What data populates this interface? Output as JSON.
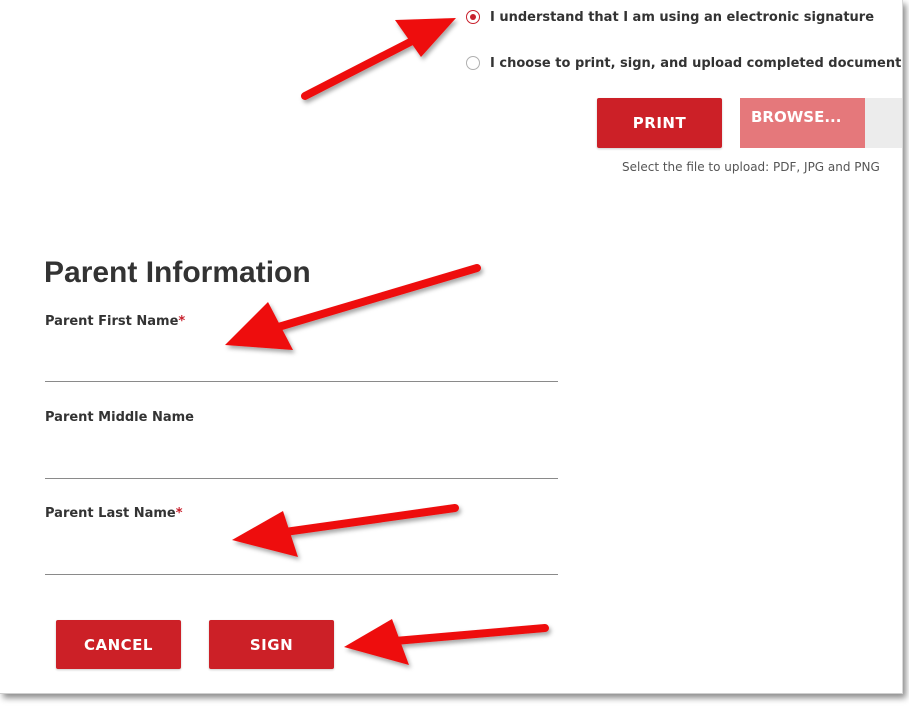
{
  "signature_options": [
    {
      "label": "I understand that I am using an electronic signature",
      "checked": true
    },
    {
      "label": "I choose to print, sign, and upload completed documents",
      "checked": false
    }
  ],
  "upload": {
    "print_label": "PRINT",
    "browse_label": "BROWSE...",
    "hint": "Select the file to upload: PDF, JPG and PNG"
  },
  "parent_info": {
    "title": "Parent Information",
    "first_name": {
      "label": "Parent First Name",
      "required_mark": "*",
      "value": "",
      "placeholder": ""
    },
    "middle_name": {
      "label": "Parent Middle Name",
      "value": "",
      "placeholder": ""
    },
    "last_name": {
      "label": "Parent Last Name",
      "required_mark": "*",
      "value": "",
      "placeholder": ""
    }
  },
  "actions": {
    "cancel_label": "CANCEL",
    "sign_label": "SIGN"
  },
  "colors": {
    "brand_red": "#cc2027",
    "browse_red_light": "#e5787b",
    "annotation_arrow": "#ee1111"
  }
}
